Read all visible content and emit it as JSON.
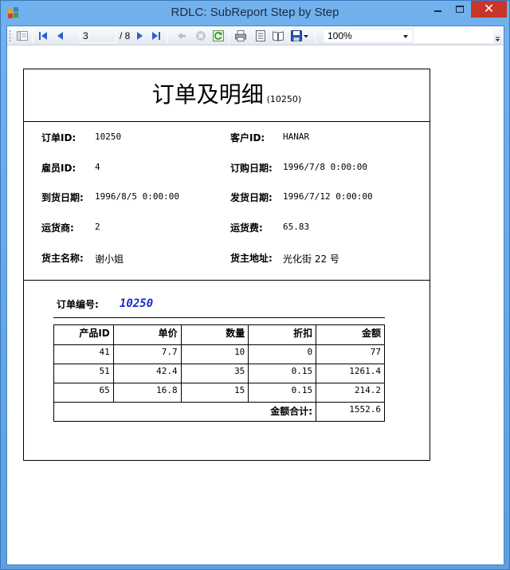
{
  "window": {
    "title": "RDLC: SubReport Step by Step"
  },
  "toolbar": {
    "current_page": "3",
    "page_of": "/ 8",
    "zoom": "100%",
    "search_placeholder": ""
  },
  "report": {
    "title": "订单及明细",
    "title_order_id": "(10250)",
    "fields": {
      "order_id_label": "订单ID:",
      "order_id": "10250",
      "customer_id_label": "客户ID:",
      "customer_id": "HANAR",
      "employee_id_label": "雇员ID:",
      "employee_id": "4",
      "order_date_label": "订购日期:",
      "order_date": "1996/7/8 0:00:00",
      "required_date_label": "到货日期:",
      "required_date": "1996/8/5 0:00:00",
      "shipped_date_label": "发货日期:",
      "shipped_date": "1996/7/12 0:00:00",
      "ship_via_label": "运货商:",
      "ship_via": "2",
      "freight_label": "运货费:",
      "freight": "65.83",
      "ship_name_label": "货主名称:",
      "ship_name": "谢小姐",
      "ship_address_label": "货主地址:",
      "ship_address": "光化街 22 号"
    },
    "subreport": {
      "order_no_label": "订单编号:",
      "order_no": "10250",
      "headers": [
        "产品ID",
        "单价",
        "数量",
        "折扣",
        "金额"
      ],
      "rows": [
        [
          "41",
          "7.7",
          "10",
          "0",
          "77"
        ],
        [
          "51",
          "42.4",
          "35",
          "0.15",
          "1261.4"
        ],
        [
          "65",
          "16.8",
          "15",
          "0.15",
          "214.2"
        ]
      ],
      "total_label": "金额合计:",
      "total": "1552.6"
    }
  }
}
